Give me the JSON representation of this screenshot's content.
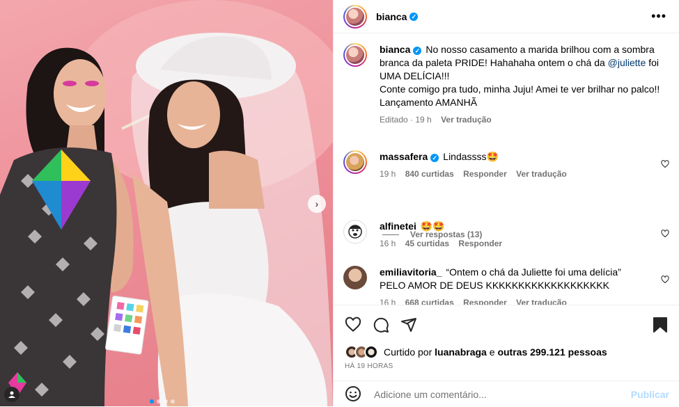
{
  "post": {
    "author": "bianca",
    "more_label": "•••",
    "image_alt": "Two women posing against a pink background"
  },
  "caption": {
    "username": "bianca",
    "text_before_mention": "No nosso casamento a marida brilhou com a sombra branca da paleta PRIDE! Hahahaha ontem o chá da ",
    "mention": "@juliette",
    "text_after_mention": " foi UMA DELÍCIA!!!",
    "line2": "Conte comigo pra tudo, minha Juju! Amei te ver brilhar no palco!!",
    "line3": "Lançamento AMANHÃ",
    "edited": "Editado · 19 h",
    "see_translation": "Ver tradução"
  },
  "comments": [
    {
      "username": "massafera",
      "verified": true,
      "text": "Lindassss🤩",
      "time": "19 h",
      "likes": "840 curtidas",
      "reply": "Responder",
      "translate": "Ver tradução"
    },
    {
      "username": "alfinetei",
      "verified": false,
      "text": "🤩🤩",
      "time": "16 h",
      "likes": "45 curtidas",
      "reply": "Responder"
    },
    {
      "username": "emiliavitoria_",
      "verified": false,
      "text": "“Ontem o chá da Juliette foi uma delícia” PELO AMOR DE DEUS KKKKKKKKKKKKKKKKKKK",
      "time": "16 h",
      "likes": "668 curtidas",
      "reply": "Responder",
      "translate": "Ver tradução"
    }
  ],
  "view_replies": "Ver respostas (13)",
  "likes": {
    "prefix": "Curtido por ",
    "user": "luanabraga",
    "middle": " e ",
    "others": "outras 299.121 pessoas"
  },
  "timestamp": "HÁ 19 HORAS",
  "add_comment": {
    "placeholder": "Adicione um comentário...",
    "publish": "Publicar"
  },
  "colors": {
    "accent": "#0095f6",
    "link": "#00376b",
    "muted": "#737373",
    "photo_bg": "#ee8f99"
  }
}
